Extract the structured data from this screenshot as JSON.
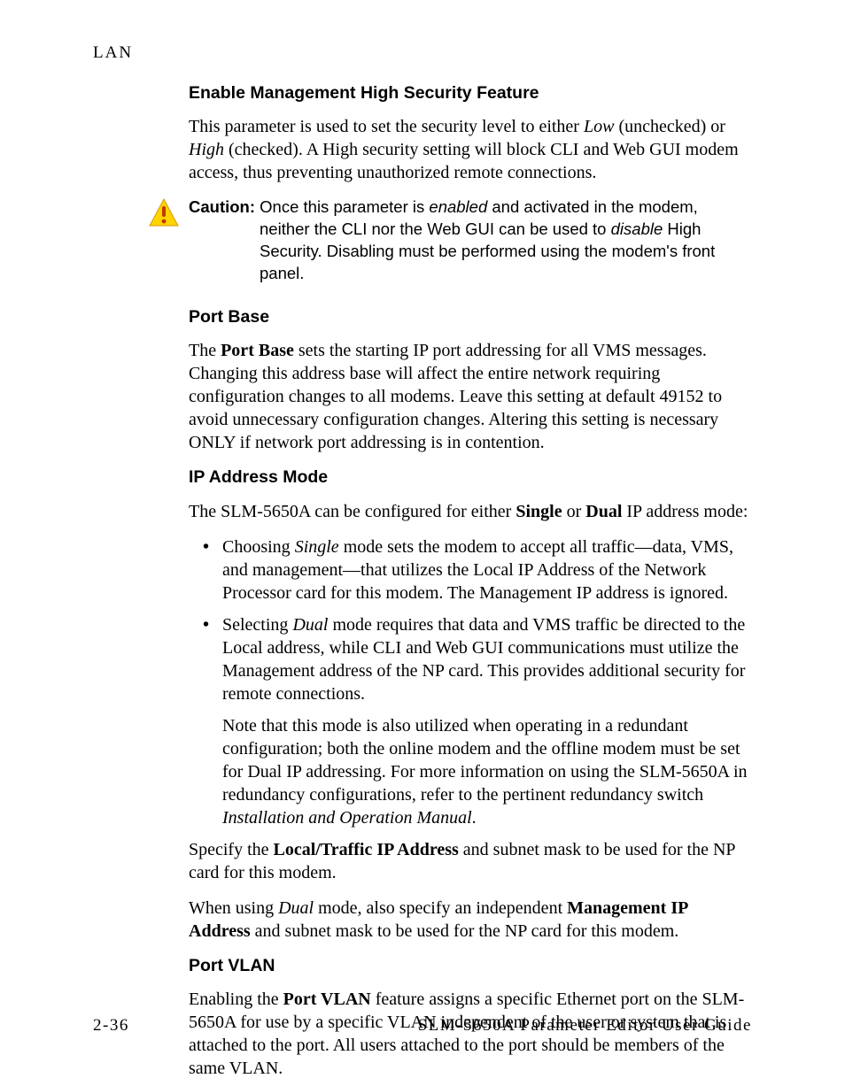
{
  "header": {
    "section": "LAN"
  },
  "sections": {
    "enable_security": {
      "heading": "Enable Management High Security Feature",
      "para_pre": "This parameter is used to set the security level to either ",
      "low": "Low",
      "para_mid1": " (unchecked) or ",
      "high": "High",
      "para_post": " (checked). A High security setting will block CLI and Web GUI modem access, thus preventing unauthorized remote connections."
    },
    "caution": {
      "label": "Caution:",
      "pre": "  Once this parameter is ",
      "enabled": "enabled",
      "mid": " and activated in the modem, neither the CLI nor the Web GUI can be used to ",
      "disable": "disable",
      "post": " High Security. Disabling must be performed using the modem's front panel."
    },
    "port_base": {
      "heading": "Port Base",
      "pre": "The ",
      "term": "Port Base",
      "post": " sets the starting IP port addressing for all VMS messages. Changing this address base will affect the entire network requiring configuration changes to all modems. Leave this setting at default 49152 to avoid unnecessary configuration changes. Altering this setting is necessary ONLY if network port addressing is in contention."
    },
    "ip_mode": {
      "heading": "IP Address Mode",
      "intro_pre": "The SLM-5650A can be configured for either ",
      "single_b": "Single",
      "intro_mid": " or ",
      "dual_b": "Dual",
      "intro_post": " IP address mode:",
      "b1_pre": "Choosing ",
      "b1_single": "Single",
      "b1_post": " mode sets the modem to accept all traffic—data, VMS, and management—that utilizes the Local IP Address of the Network Processor card for this modem. The Management IP address is ignored.",
      "b2_pre": "Selecting ",
      "b2_dual": "Dual",
      "b2_post": " mode requires that data and VMS traffic be directed to the Local address, while CLI and Web GUI communications must utilize the Management address of the NP card. This provides additional security for remote connections.",
      "b2_sub_pre": "Note that this mode is also utilized when operating in a redundant configuration; both the online modem and the offline modem must be set for Dual IP addressing. For more information on using the SLM-5650A in redundancy configurations, refer to the pertinent redundancy switch ",
      "b2_sub_em": "Installation and Operation Manual",
      "b2_sub_post": ".",
      "specify_pre": "Specify the ",
      "specify_b": "Local/Traffic IP Address",
      "specify_post": " and subnet mask to be used for the NP card for this modem.",
      "dual_pre": "When using ",
      "dual_i": "Dual",
      "dual_mid": " mode, also specify an independent ",
      "dual_b2": "Management IP Address",
      "dual_post": " and subnet mask to be used for the NP card for this modem."
    },
    "port_vlan": {
      "heading": "Port VLAN",
      "pre": "Enabling the ",
      "term": "Port VLAN",
      "post": " feature assigns a specific Ethernet port on the SLM-5650A for use by a specific VLAN independent of the user or system that is attached to the port. All users attached to the port should be members of the same VLAN."
    }
  },
  "footer": {
    "page": "2-36",
    "title": "SLM-5650A Parameter Editor User Guide"
  }
}
